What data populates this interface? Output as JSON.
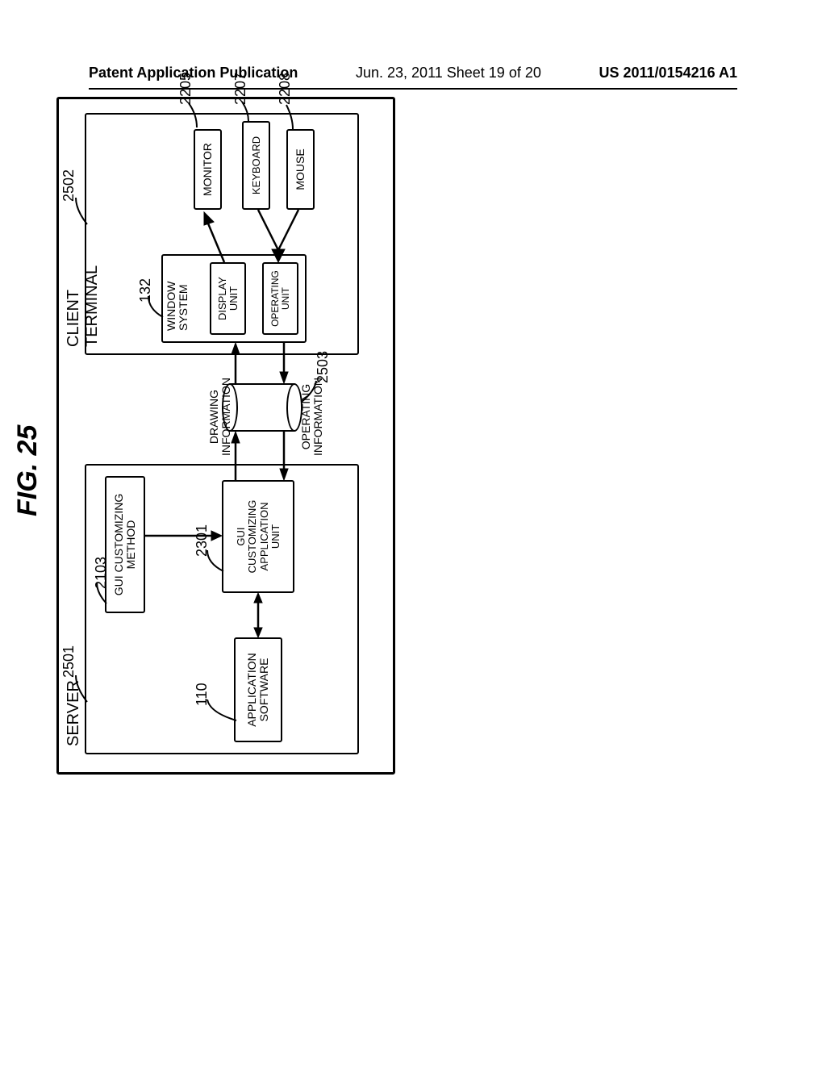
{
  "header": {
    "left": "Patent Application Publication",
    "center": "Jun. 23, 2011  Sheet 19 of 20",
    "right": "US 2011/0154216 A1"
  },
  "figure": {
    "title": "FIG. 25",
    "server": {
      "label": "SERVER",
      "ref": "2501",
      "gui_customizing_method": {
        "label": "GUI CUSTOMIZING\nMETHOD",
        "ref": "2103"
      },
      "application_software": {
        "label": "APPLICATION\nSOFTWARE",
        "ref": "110"
      },
      "gui_customizing_application_unit": {
        "label": "GUI\nCUSTOMIZING\nAPPLICATION\nUNIT",
        "ref": "2301"
      }
    },
    "client": {
      "label": "CLIENT TERMINAL",
      "ref": "2502",
      "window_system": {
        "label": "WINDOW\nSYSTEM",
        "ref": "132"
      },
      "display_unit": {
        "label": "DISPLAY\nUNIT"
      },
      "operating_unit": {
        "label": "OPERATING\nUNIT"
      },
      "monitor": {
        "label": "MONITOR",
        "ref": "2205"
      },
      "keyboard": {
        "label": "KEYBOARD",
        "ref": "2207"
      },
      "mouse": {
        "label": "MOUSE",
        "ref": "2208"
      }
    },
    "network": {
      "ref": "2503",
      "drawing_info": "DRAWING\nINFORMATION",
      "operating_info": "OPERATING\nINFORMATION"
    }
  }
}
